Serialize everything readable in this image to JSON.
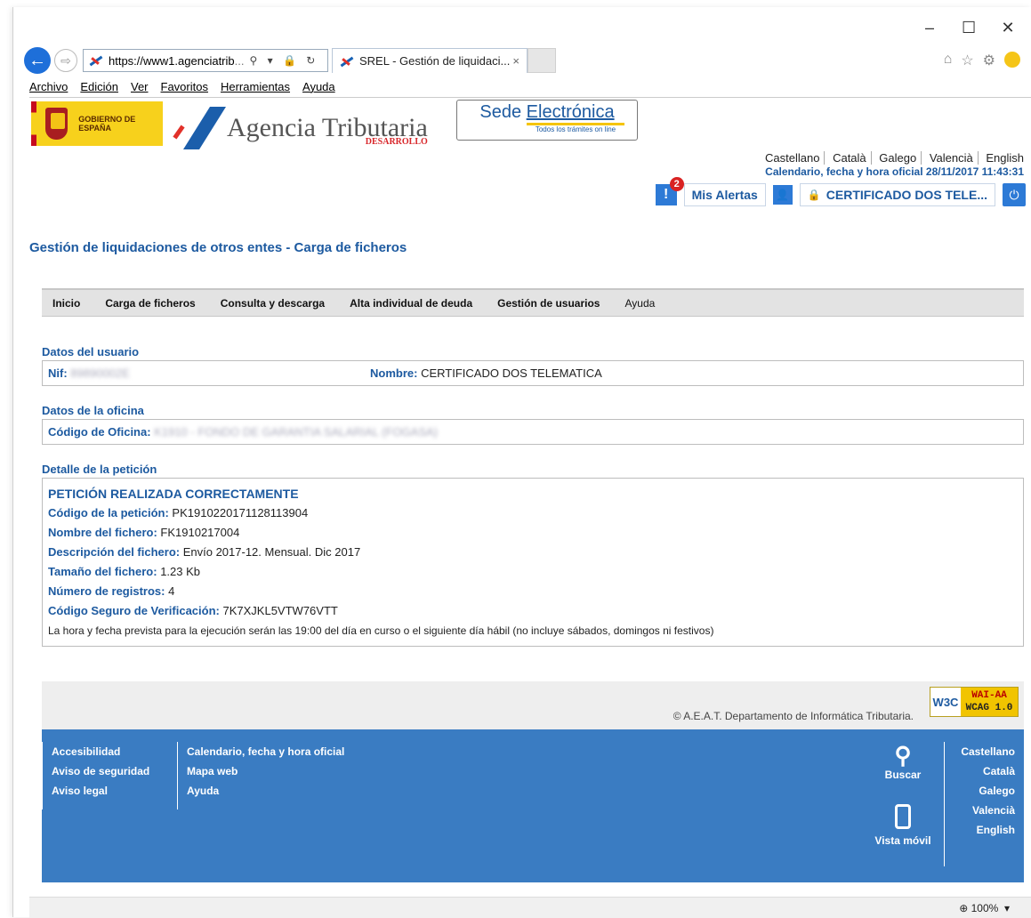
{
  "browser": {
    "url_host": "https://www1.agenciatrib",
    "url_rest": "...",
    "tab_title": "SREL - Gestión de liquidaci...",
    "window_controls": [
      "–",
      "☐",
      "✕"
    ],
    "menu": [
      "Archivo",
      "Edición",
      "Ver",
      "Favoritos",
      "Herramientas",
      "Ayuda"
    ],
    "zoom": "100%"
  },
  "header": {
    "gobierno": "GOBIERNO DE ESPAÑA",
    "agency": "Agencia Tributaria",
    "env": "DESARROLLO",
    "sede_title_1": "Sede",
    "sede_title_2": "Electrónica",
    "sede_sub": "Todos los trámites on line",
    "languages": [
      "Castellano",
      "Català",
      "Galego",
      "Valencià",
      "English"
    ],
    "clock": "Calendario, fecha y hora oficial 28/11/2017 11:43:31",
    "alerts_count": "2",
    "alerts_label": "Mis Alertas",
    "user_label": "CERTIFICADO DOS TELE..."
  },
  "page_title": "Gestión de liquidaciones de otros entes - Carga de ficheros",
  "nav": [
    "Inicio",
    "Carga de ficheros",
    "Consulta y descarga",
    "Alta individual de deuda",
    "Gestión de usuarios",
    "Ayuda"
  ],
  "user": {
    "section": "Datos del usuario",
    "nif_label": "Nif:",
    "nif_value": "89890002E",
    "name_label": "Nombre:",
    "name_value": "CERTIFICADO DOS TELEMATICA"
  },
  "office": {
    "section": "Datos de la oficina",
    "code_label": "Código de Oficina:",
    "code_value": "K1910 - FONDO DE GARANTIA SALARIAL (FOGASA)"
  },
  "detail": {
    "section": "Detalle de la petición",
    "status": "PETICIÓN REALIZADA CORRECTAMENTE",
    "fields": [
      {
        "label": "Código de la petición:",
        "value": "PK1910220171128113904"
      },
      {
        "label": "Nombre del fichero:",
        "value": "FK1910217004"
      },
      {
        "label": "Descripción del fichero:",
        "value": "Envío 2017-12. Mensual. Dic 2017"
      },
      {
        "label": "Tamaño del fichero:",
        "value": "1.23 Kb"
      },
      {
        "label": "Número de registros:",
        "value": "4"
      },
      {
        "label": "Código Seguro de Verificación:",
        "value": "7K7XJKL5VTW76VTT"
      }
    ],
    "note": "La hora y fecha prevista para la ejecución serán las 19:00 del día en curso o el siguiente día hábil (no incluye sábados, domingos ni festivos)"
  },
  "footer": {
    "copyright": "© A.E.A.T. Departamento de Informática Tributaria.",
    "w3c": "W3C",
    "wai_1": "WAI-AA",
    "wai_2": "WCAG 1.0",
    "col1": [
      "Accesibilidad",
      "Aviso de seguridad",
      "Aviso legal"
    ],
    "col2": [
      "Calendario, fecha y hora oficial",
      "Mapa web",
      "Ayuda"
    ],
    "search": "Buscar",
    "mobile": "Vista móvil",
    "langs": [
      "Castellano",
      "Català",
      "Galego",
      "Valencià",
      "English"
    ]
  }
}
